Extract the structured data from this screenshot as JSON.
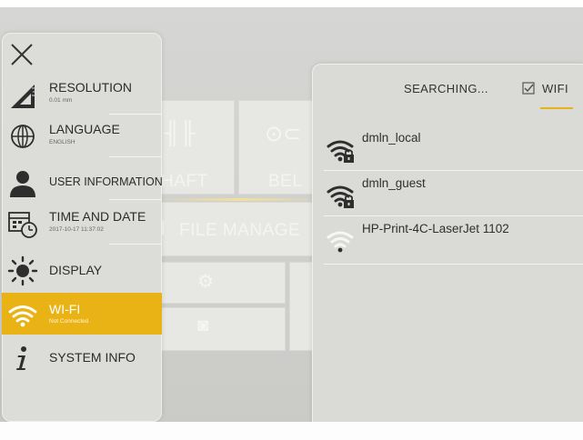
{
  "background_menu": {
    "tiles": [
      {
        "name": "tile-shaft",
        "label": "HAFT"
      },
      {
        "name": "tile-belt",
        "label": "BEL"
      },
      {
        "name": "tile-file-manager",
        "label": "FILE MANAGE"
      }
    ]
  },
  "settings": {
    "items": [
      {
        "name": "resolution",
        "label": "RESOLUTION",
        "sub": "0.01 mm",
        "icon": "ruler-triangle-icon"
      },
      {
        "name": "language",
        "label": "LANGUAGE",
        "sub": "ENGLISH",
        "icon": "globe-icon"
      },
      {
        "name": "user-information",
        "label": "USER INFORMATION",
        "sub": "",
        "icon": "user-icon"
      },
      {
        "name": "time-and-date",
        "label": "TIME AND DATE",
        "sub": "2017-10-17 11:37:02",
        "icon": "calendar-clock-icon"
      },
      {
        "name": "display",
        "label": "DISPLAY",
        "sub": "",
        "icon": "sun-icon"
      },
      {
        "name": "wi-fi",
        "label": "WI-FI",
        "sub": "Not Connected",
        "icon": "wifi-icon",
        "active": true
      },
      {
        "name": "system-info",
        "label": "SYSTEM INFO",
        "sub": "",
        "icon": "info-icon"
      }
    ]
  },
  "wifi": {
    "status": "SEARCHING...",
    "toggle_label": "WIFI",
    "toggle_checked": true,
    "networks": [
      {
        "ssid": "dmln_local",
        "secured": true
      },
      {
        "ssid": "dmln_guest",
        "secured": true
      },
      {
        "ssid": "HP-Print-4C-LaserJet 1102",
        "secured": false
      }
    ]
  },
  "colors": {
    "accent": "#eab315",
    "panel": "#dcdcd8"
  }
}
